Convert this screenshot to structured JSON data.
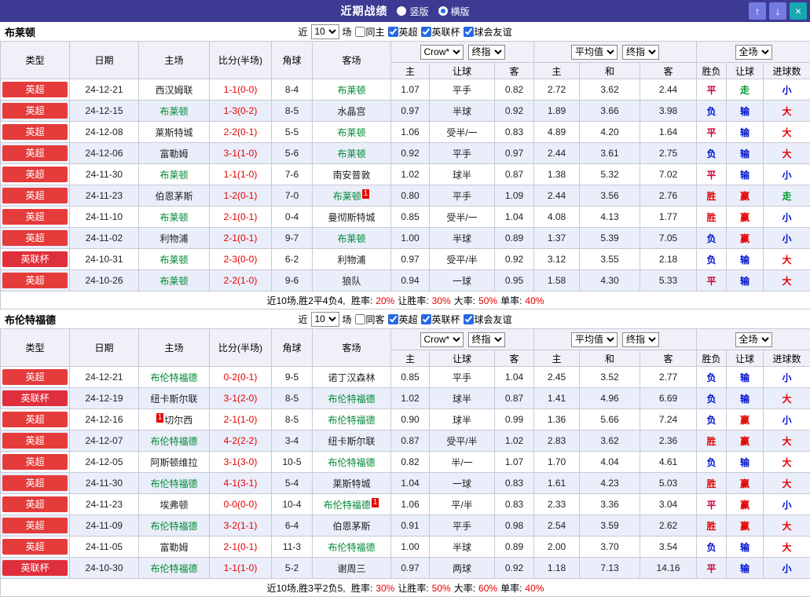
{
  "topbar": {
    "title": "近期战绩",
    "vertical_label": "竖版",
    "horizontal_label": "横版",
    "selected_layout": "横版",
    "up_icon": "↑",
    "down_icon": "↓",
    "close_icon": "×"
  },
  "colors": {
    "topbar_bg": "#3d3a94",
    "nav_button_bg": "#757ae0",
    "close_button_bg": "#17a8b0",
    "league_badge": {
      "英超": "#e53b3b",
      "英联杯": "#e02f3c"
    },
    "focus_team": "#008833",
    "score": "#e60000",
    "row_alt_bg": "#e9eefa",
    "header_bg": "#f0f0f8",
    "result": {
      "胜": "#e60000",
      "平": "#cc0033",
      "负": "#0011cc",
      "赢": "#e60000",
      "输": "#0011cc",
      "走": "#009933",
      "大": "#e60000",
      "小": "#0011cc"
    }
  },
  "table_header": {
    "left_cols": [
      "类型",
      "日期",
      "主场",
      "比分(半场)",
      "角球",
      "客场"
    ],
    "group1_selects": [
      "Crow*",
      "终指"
    ],
    "group2_selects": [
      "平均值",
      "终指"
    ],
    "group3_selects": [
      "全场"
    ],
    "sub_cols_group1": [
      "主",
      "让球",
      "客"
    ],
    "sub_cols_group2": [
      "主",
      "和",
      "客"
    ],
    "sub_cols_group3": [
      "胜负",
      "让球",
      "进球数"
    ]
  },
  "sections": [
    {
      "team": "布莱顿",
      "filter": {
        "near_label": "近",
        "count_value": "10",
        "games_label": "场",
        "checkboxes": [
          {
            "label": "同主",
            "checked": false
          },
          {
            "label": "英超",
            "checked": true
          },
          {
            "label": "英联杯",
            "checked": true
          },
          {
            "label": "球会友谊",
            "checked": true
          }
        ]
      },
      "rows": [
        {
          "league": "英超",
          "date": "24-12-21",
          "home": {
            "name": "西汉姆联",
            "focus": false
          },
          "score": "1-1(0-0)",
          "corner": "8-4",
          "away": {
            "name": "布莱顿",
            "focus": true
          },
          "odds1": [
            "1.07",
            "平手",
            "0.82"
          ],
          "odds2": [
            "2.72",
            "3.62",
            "2.44"
          ],
          "results": [
            "平",
            "走",
            "小"
          ]
        },
        {
          "league": "英超",
          "date": "24-12-15",
          "home": {
            "name": "布莱顿",
            "focus": true
          },
          "score": "1-3(0-2)",
          "corner": "8-5",
          "away": {
            "name": "水晶宫",
            "focus": false
          },
          "odds1": [
            "0.97",
            "半球",
            "0.92"
          ],
          "odds2": [
            "1.89",
            "3.66",
            "3.98"
          ],
          "results": [
            "负",
            "输",
            "大"
          ]
        },
        {
          "league": "英超",
          "date": "24-12-08",
          "home": {
            "name": "莱斯特城",
            "focus": false
          },
          "score": "2-2(0-1)",
          "corner": "5-5",
          "away": {
            "name": "布莱顿",
            "focus": true
          },
          "odds1": [
            "1.06",
            "受半/一",
            "0.83"
          ],
          "odds2": [
            "4.89",
            "4.20",
            "1.64"
          ],
          "results": [
            "平",
            "输",
            "大"
          ]
        },
        {
          "league": "英超",
          "date": "24-12-06",
          "home": {
            "name": "富勒姆",
            "focus": false
          },
          "score": "3-1(1-0)",
          "corner": "5-6",
          "away": {
            "name": "布莱顿",
            "focus": true
          },
          "odds1": [
            "0.92",
            "平手",
            "0.97"
          ],
          "odds2": [
            "2.44",
            "3.61",
            "2.75"
          ],
          "results": [
            "负",
            "输",
            "大"
          ]
        },
        {
          "league": "英超",
          "date": "24-11-30",
          "home": {
            "name": "布莱顿",
            "focus": true
          },
          "score": "1-1(1-0)",
          "corner": "7-6",
          "away": {
            "name": "南安普敦",
            "focus": false
          },
          "odds1": [
            "1.02",
            "球半",
            "0.87"
          ],
          "odds2": [
            "1.38",
            "5.32",
            "7.02"
          ],
          "results": [
            "平",
            "输",
            "小"
          ]
        },
        {
          "league": "英超",
          "date": "24-11-23",
          "home": {
            "name": "伯恩茅斯",
            "focus": false
          },
          "score": "1-2(0-1)",
          "corner": "7-0",
          "away": {
            "name": "布莱顿",
            "focus": true,
            "card_after": "1"
          },
          "odds1": [
            "0.80",
            "平手",
            "1.09"
          ],
          "odds2": [
            "2.44",
            "3.56",
            "2.76"
          ],
          "results": [
            "胜",
            "赢",
            "走"
          ]
        },
        {
          "league": "英超",
          "date": "24-11-10",
          "home": {
            "name": "布莱顿",
            "focus": true
          },
          "score": "2-1(0-1)",
          "corner": "0-4",
          "away": {
            "name": "曼彻斯特城",
            "focus": false
          },
          "odds1": [
            "0.85",
            "受半/一",
            "1.04"
          ],
          "odds2": [
            "4.08",
            "4.13",
            "1.77"
          ],
          "results": [
            "胜",
            "赢",
            "小"
          ]
        },
        {
          "league": "英超",
          "date": "24-11-02",
          "home": {
            "name": "利物浦",
            "focus": false
          },
          "score": "2-1(0-1)",
          "corner": "9-7",
          "away": {
            "name": "布莱顿",
            "focus": true
          },
          "odds1": [
            "1.00",
            "半球",
            "0.89"
          ],
          "odds2": [
            "1.37",
            "5.39",
            "7.05"
          ],
          "results": [
            "负",
            "赢",
            "小"
          ]
        },
        {
          "league": "英联杯",
          "date": "24-10-31",
          "home": {
            "name": "布莱顿",
            "focus": true
          },
          "score": "2-3(0-0)",
          "corner": "6-2",
          "away": {
            "name": "利物浦",
            "focus": false
          },
          "odds1": [
            "0.97",
            "受平/半",
            "0.92"
          ],
          "odds2": [
            "3.12",
            "3.55",
            "2.18"
          ],
          "results": [
            "负",
            "输",
            "大"
          ]
        },
        {
          "league": "英超",
          "date": "24-10-26",
          "home": {
            "name": "布莱顿",
            "focus": true
          },
          "score": "2-2(1-0)",
          "corner": "9-6",
          "away": {
            "name": "狼队",
            "focus": false
          },
          "odds1": [
            "0.94",
            "一球",
            "0.95"
          ],
          "odds2": [
            "1.58",
            "4.30",
            "5.33"
          ],
          "results": [
            "平",
            "输",
            "大"
          ]
        }
      ],
      "summary": [
        {
          "text": "近10场,胜2平4负4, ",
          "red": false
        },
        {
          "text": "胜率:",
          "red": false
        },
        {
          "text": "20%",
          "red": true
        },
        {
          "text": "让胜率:",
          "red": false
        },
        {
          "text": "30%",
          "red": true
        },
        {
          "text": "大率:",
          "red": false
        },
        {
          "text": "50%",
          "red": true
        },
        {
          "text": "单率:",
          "red": false
        },
        {
          "text": "40%",
          "red": true
        }
      ]
    },
    {
      "team": "布伦特福德",
      "filter": {
        "near_label": "近",
        "count_value": "10",
        "games_label": "场",
        "checkboxes": [
          {
            "label": "同客",
            "checked": false
          },
          {
            "label": "英超",
            "checked": true
          },
          {
            "label": "英联杯",
            "checked": true
          },
          {
            "label": "球会友谊",
            "checked": true
          }
        ]
      },
      "rows": [
        {
          "league": "英超",
          "date": "24-12-21",
          "home": {
            "name": "布伦特福德",
            "focus": true
          },
          "score": "0-2(0-1)",
          "corner": "9-5",
          "away": {
            "name": "诺丁汉森林",
            "focus": false
          },
          "odds1": [
            "0.85",
            "平手",
            "1.04"
          ],
          "odds2": [
            "2.45",
            "3.52",
            "2.77"
          ],
          "results": [
            "负",
            "输",
            "小"
          ]
        },
        {
          "league": "英联杯",
          "date": "24-12-19",
          "home": {
            "name": "纽卡斯尔联",
            "focus": false
          },
          "score": "3-1(2-0)",
          "corner": "8-5",
          "away": {
            "name": "布伦特福德",
            "focus": true
          },
          "odds1": [
            "1.02",
            "球半",
            "0.87"
          ],
          "odds2": [
            "1.41",
            "4.96",
            "6.69"
          ],
          "results": [
            "负",
            "输",
            "大"
          ]
        },
        {
          "league": "英超",
          "date": "24-12-16",
          "home": {
            "name": "切尔西",
            "focus": false,
            "card_before": "1"
          },
          "score": "2-1(1-0)",
          "corner": "8-5",
          "away": {
            "name": "布伦特福德",
            "focus": true
          },
          "odds1": [
            "0.90",
            "球半",
            "0.99"
          ],
          "odds2": [
            "1.36",
            "5.66",
            "7.24"
          ],
          "results": [
            "负",
            "赢",
            "小"
          ]
        },
        {
          "league": "英超",
          "date": "24-12-07",
          "home": {
            "name": "布伦特福德",
            "focus": true
          },
          "score": "4-2(2-2)",
          "corner": "3-4",
          "away": {
            "name": "纽卡斯尔联",
            "focus": false
          },
          "odds1": [
            "0.87",
            "受平/半",
            "1.02"
          ],
          "odds2": [
            "2.83",
            "3.62",
            "2.36"
          ],
          "results": [
            "胜",
            "赢",
            "大"
          ]
        },
        {
          "league": "英超",
          "date": "24-12-05",
          "home": {
            "name": "阿斯顿维拉",
            "focus": false
          },
          "score": "3-1(3-0)",
          "corner": "10-5",
          "away": {
            "name": "布伦特福德",
            "focus": true
          },
          "odds1": [
            "0.82",
            "半/一",
            "1.07"
          ],
          "odds2": [
            "1.70",
            "4.04",
            "4.61"
          ],
          "results": [
            "负",
            "输",
            "大"
          ]
        },
        {
          "league": "英超",
          "date": "24-11-30",
          "home": {
            "name": "布伦特福德",
            "focus": true
          },
          "score": "4-1(3-1)",
          "corner": "5-4",
          "away": {
            "name": "莱斯特城",
            "focus": false
          },
          "odds1": [
            "1.04",
            "一球",
            "0.83"
          ],
          "odds2": [
            "1.61",
            "4.23",
            "5.03"
          ],
          "results": [
            "胜",
            "赢",
            "大"
          ]
        },
        {
          "league": "英超",
          "date": "24-11-23",
          "home": {
            "name": "埃弗顿",
            "focus": false
          },
          "score": "0-0(0-0)",
          "corner": "10-4",
          "away": {
            "name": "布伦特福德",
            "focus": true,
            "card_after": "1"
          },
          "odds1": [
            "1.06",
            "平/半",
            "0.83"
          ],
          "odds2": [
            "2.33",
            "3.36",
            "3.04"
          ],
          "results": [
            "平",
            "赢",
            "小"
          ]
        },
        {
          "league": "英超",
          "date": "24-11-09",
          "home": {
            "name": "布伦特福德",
            "focus": true
          },
          "score": "3-2(1-1)",
          "corner": "6-4",
          "away": {
            "name": "伯恩茅斯",
            "focus": false
          },
          "odds1": [
            "0.91",
            "平手",
            "0.98"
          ],
          "odds2": [
            "2.54",
            "3.59",
            "2.62"
          ],
          "results": [
            "胜",
            "赢",
            "大"
          ]
        },
        {
          "league": "英超",
          "date": "24-11-05",
          "home": {
            "name": "富勒姆",
            "focus": false
          },
          "score": "2-1(0-1)",
          "corner": "11-3",
          "away": {
            "name": "布伦特福德",
            "focus": true
          },
          "odds1": [
            "1.00",
            "半球",
            "0.89"
          ],
          "odds2": [
            "2.00",
            "3.70",
            "3.54"
          ],
          "results": [
            "负",
            "输",
            "大"
          ]
        },
        {
          "league": "英联杯",
          "date": "24-10-30",
          "home": {
            "name": "布伦特福德",
            "focus": true
          },
          "score": "1-1(1-0)",
          "corner": "5-2",
          "away": {
            "name": "谢周三",
            "focus": false
          },
          "odds1": [
            "0.97",
            "两球",
            "0.92"
          ],
          "odds2": [
            "1.18",
            "7.13",
            "14.16"
          ],
          "results": [
            "平",
            "输",
            "小"
          ]
        }
      ],
      "summary": [
        {
          "text": "近10场,胜3平2负5, ",
          "red": false
        },
        {
          "text": "胜率:",
          "red": false
        },
        {
          "text": "30%",
          "red": true
        },
        {
          "text": "让胜率:",
          "red": false
        },
        {
          "text": "50%",
          "red": true
        },
        {
          "text": "大率:",
          "red": false
        },
        {
          "text": "60%",
          "red": true
        },
        {
          "text": "单率:",
          "red": false
        },
        {
          "text": "40%",
          "red": true
        }
      ]
    }
  ]
}
